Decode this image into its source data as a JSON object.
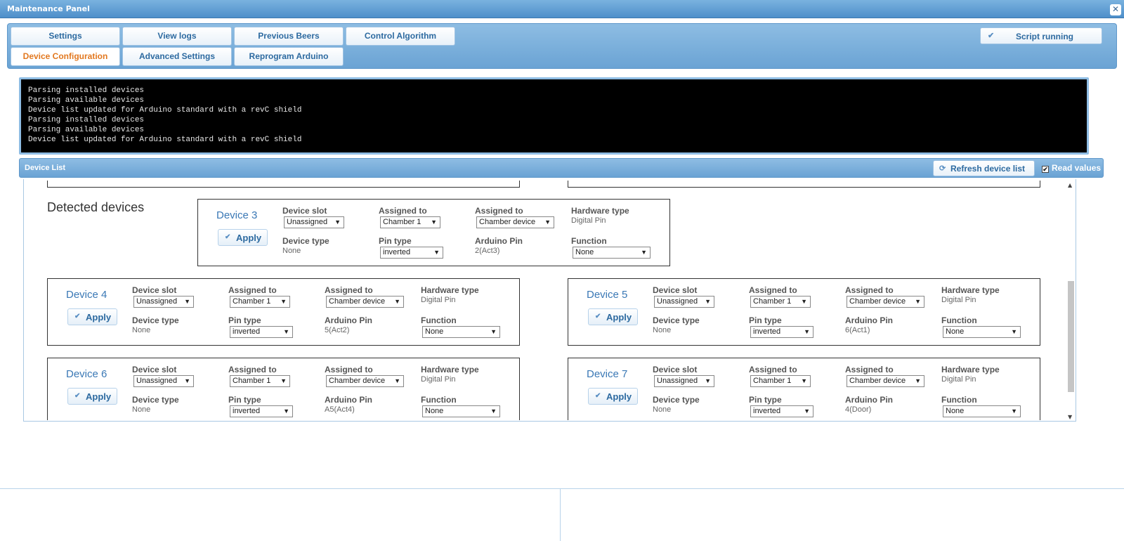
{
  "window": {
    "title": "Maintenance Panel",
    "close": "✕"
  },
  "tabs": {
    "row1": [
      "Settings",
      "View logs",
      "Previous Beers",
      "Control Algorithm"
    ],
    "row2": [
      "Device Configuration",
      "Advanced Settings",
      "Reprogram Arduino"
    ],
    "active": "Device Configuration"
  },
  "status": {
    "label": "Script running",
    "icon": "check-icon"
  },
  "console": {
    "lines": "Parsing installed devices\nParsing available devices\nDevice list updated for Arduino standard with a revC shield\nParsing installed devices\nParsing available devices\nDevice list updated for Arduino standard with a revC shield"
  },
  "device_list": {
    "title": "Device List",
    "refresh_label": "Refresh device list",
    "read_values_label": "Read values",
    "read_values_checked": true,
    "detected_title": "Detected devices"
  },
  "field_labels": {
    "slot": "Device slot",
    "assigned": "Assigned to",
    "hardware": "Hardware type",
    "dtype": "Device type",
    "pintype": "Pin type",
    "pin": "Arduino Pin",
    "function": "Function",
    "apply": "Apply"
  },
  "devices": [
    {
      "name": "Device 3",
      "slot": "Unassigned",
      "chamber": "Chamber 1",
      "assigned_device": "Chamber device",
      "hardware": "Digital Pin",
      "dtype": "None",
      "pintype": "inverted",
      "pin": "2(Act3)",
      "function": "None"
    },
    {
      "name": "Device 4",
      "slot": "Unassigned",
      "chamber": "Chamber 1",
      "assigned_device": "Chamber device",
      "hardware": "Digital Pin",
      "dtype": "None",
      "pintype": "inverted",
      "pin": "5(Act2)",
      "function": "None"
    },
    {
      "name": "Device 5",
      "slot": "Unassigned",
      "chamber": "Chamber 1",
      "assigned_device": "Chamber device",
      "hardware": "Digital Pin",
      "dtype": "None",
      "pintype": "inverted",
      "pin": "6(Act1)",
      "function": "None"
    },
    {
      "name": "Device 6",
      "slot": "Unassigned",
      "chamber": "Chamber 1",
      "assigned_device": "Chamber device",
      "hardware": "Digital Pin",
      "dtype": "None",
      "pintype": "inverted",
      "pin": "A5(Act4)",
      "function": "None"
    },
    {
      "name": "Device 7",
      "slot": "Unassigned",
      "chamber": "Chamber 1",
      "assigned_device": "Chamber device",
      "hardware": "Digital Pin",
      "dtype": "None",
      "pintype": "inverted",
      "pin": "4(Door)",
      "function": "None"
    }
  ],
  "colors": {
    "header_blue": "#6aa3d4",
    "active_tab": "#e2781f",
    "link_blue": "#3a78b5"
  }
}
